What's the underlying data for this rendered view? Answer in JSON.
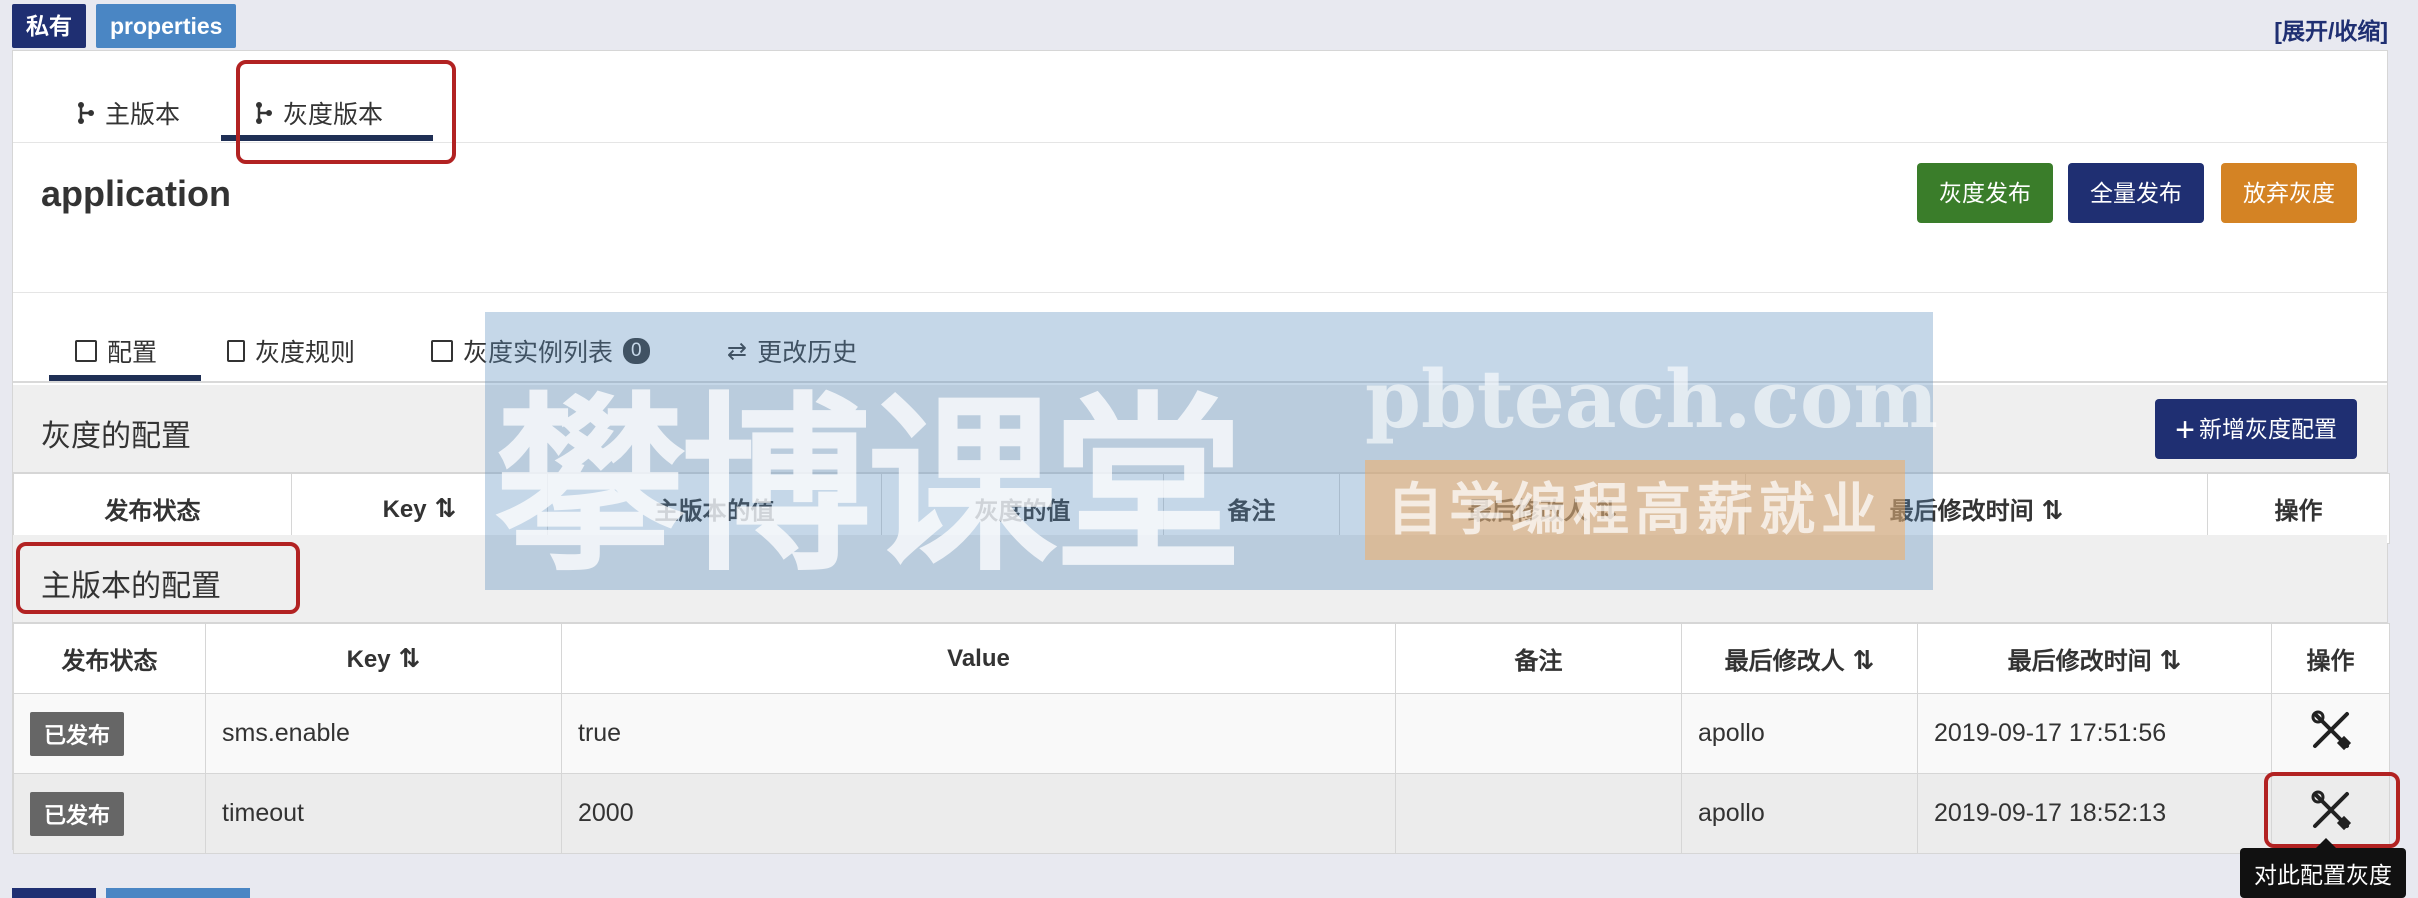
{
  "top": {
    "tag_private": "私有",
    "tag_properties": "properties",
    "toggle": "[展开/收缩]"
  },
  "branch_tabs": [
    {
      "label": "主版本"
    },
    {
      "label": "灰度版本"
    }
  ],
  "app": {
    "name": "application"
  },
  "actions": {
    "gray_release": "灰度发布",
    "full_release": "全量发布",
    "abandon_gray": "放弃灰度"
  },
  "sub_tabs": [
    {
      "label": "配置"
    },
    {
      "label": "灰度规则"
    },
    {
      "label": "灰度实例列表",
      "badge": "0"
    },
    {
      "label": "更改历史"
    }
  ],
  "gray_section": {
    "title": "灰度的配置",
    "add_label": "新增灰度配置",
    "columns": [
      "发布状态",
      "Key",
      "主版本的值",
      "灰度的值",
      "备注",
      "最后修改人",
      "最后修改时间",
      "操作"
    ]
  },
  "main_section": {
    "title": "主版本的配置",
    "columns": [
      "发布状态",
      "Key",
      "Value",
      "备注",
      "最后修改人",
      "最后修改时间",
      "操作"
    ],
    "rows": [
      {
        "status": "已发布",
        "key": "sms.enable",
        "value": "true",
        "comment": "",
        "modifier": "apollo",
        "time": "2019-09-17 17:51:56"
      },
      {
        "status": "已发布",
        "key": "timeout",
        "value": "2000",
        "comment": "",
        "modifier": "apollo",
        "time": "2019-09-17 18:52:13"
      }
    ]
  },
  "tooltip": "对此配置灰度",
  "watermark": {
    "cn": "攀博课堂",
    "en": "pbteach.com",
    "slogan": "自学编程高薪就业"
  },
  "sort_glyph": "⇅"
}
